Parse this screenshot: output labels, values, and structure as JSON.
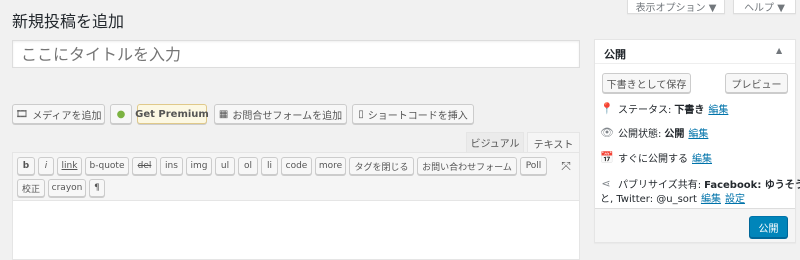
{
  "screen_options": {
    "display_options": "表示オプション ▼",
    "help": "ヘルプ ▼"
  },
  "page_title": "新規投稿を追加",
  "title_placeholder": "ここにタイトルを入力",
  "media_buttons": {
    "add_media": "メディアを追加",
    "get_premium": "Get Premium",
    "add_contact_form": "お問合せフォームを追加",
    "insert_shortcode": "ショートコードを挿入"
  },
  "editor_tabs": {
    "visual": "ビジュアル",
    "text": "テキスト"
  },
  "quicktags_row1": [
    "b",
    "i",
    "link",
    "b-quote",
    "del",
    "ins",
    "img",
    "ul",
    "ol",
    "li",
    "code",
    "more",
    "タグを閉じる",
    "お問い合わせフォーム",
    "Poll"
  ],
  "quicktags_row2": [
    "校正",
    "crayon",
    "¶"
  ],
  "publish_box": {
    "title": "公開",
    "save_draft": "下書きとして保存",
    "preview": "プレビュー",
    "status_label": "ステータス:",
    "status_value": "下書き",
    "status_edit": "編集",
    "visibility_label": "公開状態:",
    "visibility_value": "公開",
    "visibility_edit": "編集",
    "schedule_label": "すぐに公開する",
    "schedule_edit": "編集",
    "publicize_label": "パブリサイズ共有:",
    "publicize_facebook": "Facebook: ゆうそう",
    "publicize_twitter_prefix": "と, Twitter: @u_sort",
    "publicize_edit": "編集",
    "publicize_settings": "設定",
    "publish_button": "公開"
  },
  "colors": {
    "accent": "#0085ba",
    "link": "#0073aa",
    "premium_bg": "#fcf8e3"
  }
}
